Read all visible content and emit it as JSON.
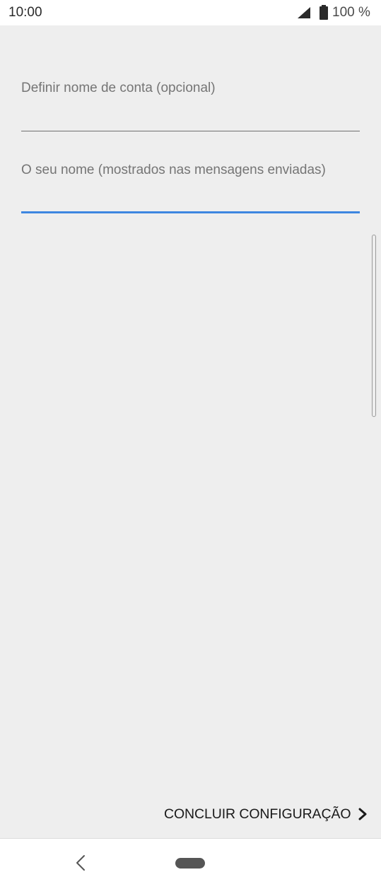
{
  "status_bar": {
    "time": "10:00",
    "battery": "100 %",
    "icons": [
      "signal-icon",
      "battery-icon"
    ]
  },
  "form": {
    "account_name": {
      "label": "Definir nome de conta (opcional)",
      "value": ""
    },
    "your_name": {
      "label": "O seu nome (mostrados nas mensagens enviadas)",
      "value": "",
      "focused": true
    }
  },
  "actions": {
    "finish_label": "CONCLUIR CONFIGURAÇÃO",
    "finish_icon": "chevron-right-icon"
  },
  "nav_bar": {
    "icons": [
      "back-icon",
      "home-pill"
    ]
  },
  "colors": {
    "background": "#eeeeee",
    "accent": "#3d86e0",
    "label": "#757575"
  }
}
